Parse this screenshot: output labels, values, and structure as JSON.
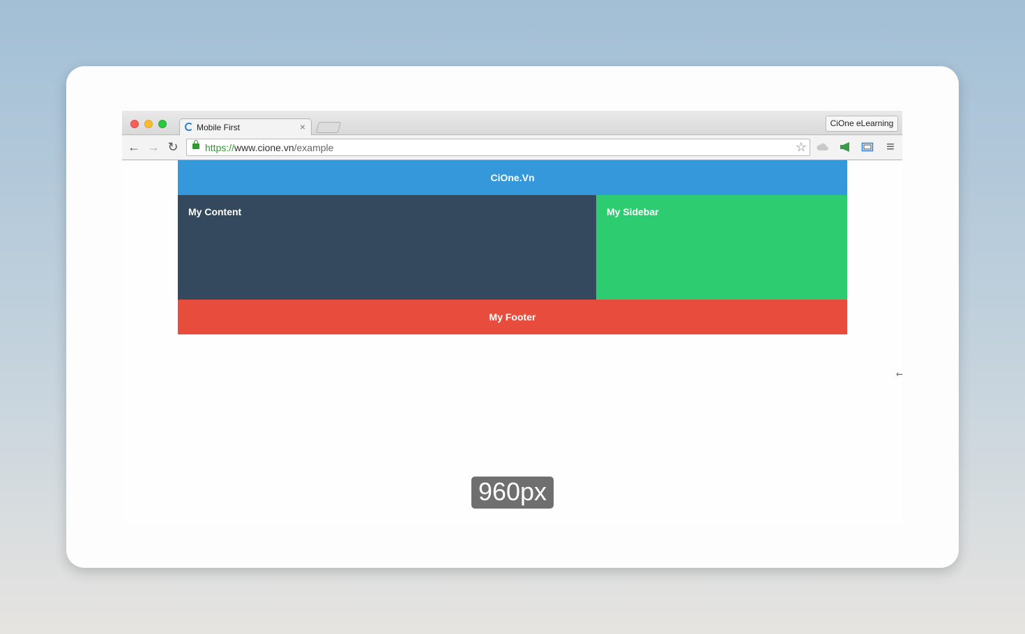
{
  "browser": {
    "tab_title": "Mobile First",
    "tab_close": "×",
    "profile_label": "CiOne eLearning",
    "url": {
      "scheme": "https://",
      "host": "www.cione.vn",
      "path": "/example"
    },
    "nav": {
      "back": "←",
      "forward": "→",
      "reload": "↻",
      "star": "☆",
      "menu": "≡"
    }
  },
  "site": {
    "header": "CiOne.Vn",
    "content": "My Content",
    "sidebar": "My Sidebar",
    "footer": "My Footer"
  },
  "overlay": {
    "width_badge": "960px"
  },
  "colors": {
    "header": "#3498db",
    "content": "#34495e",
    "sidebar": "#2ecc71",
    "footer": "#e74c3c"
  }
}
